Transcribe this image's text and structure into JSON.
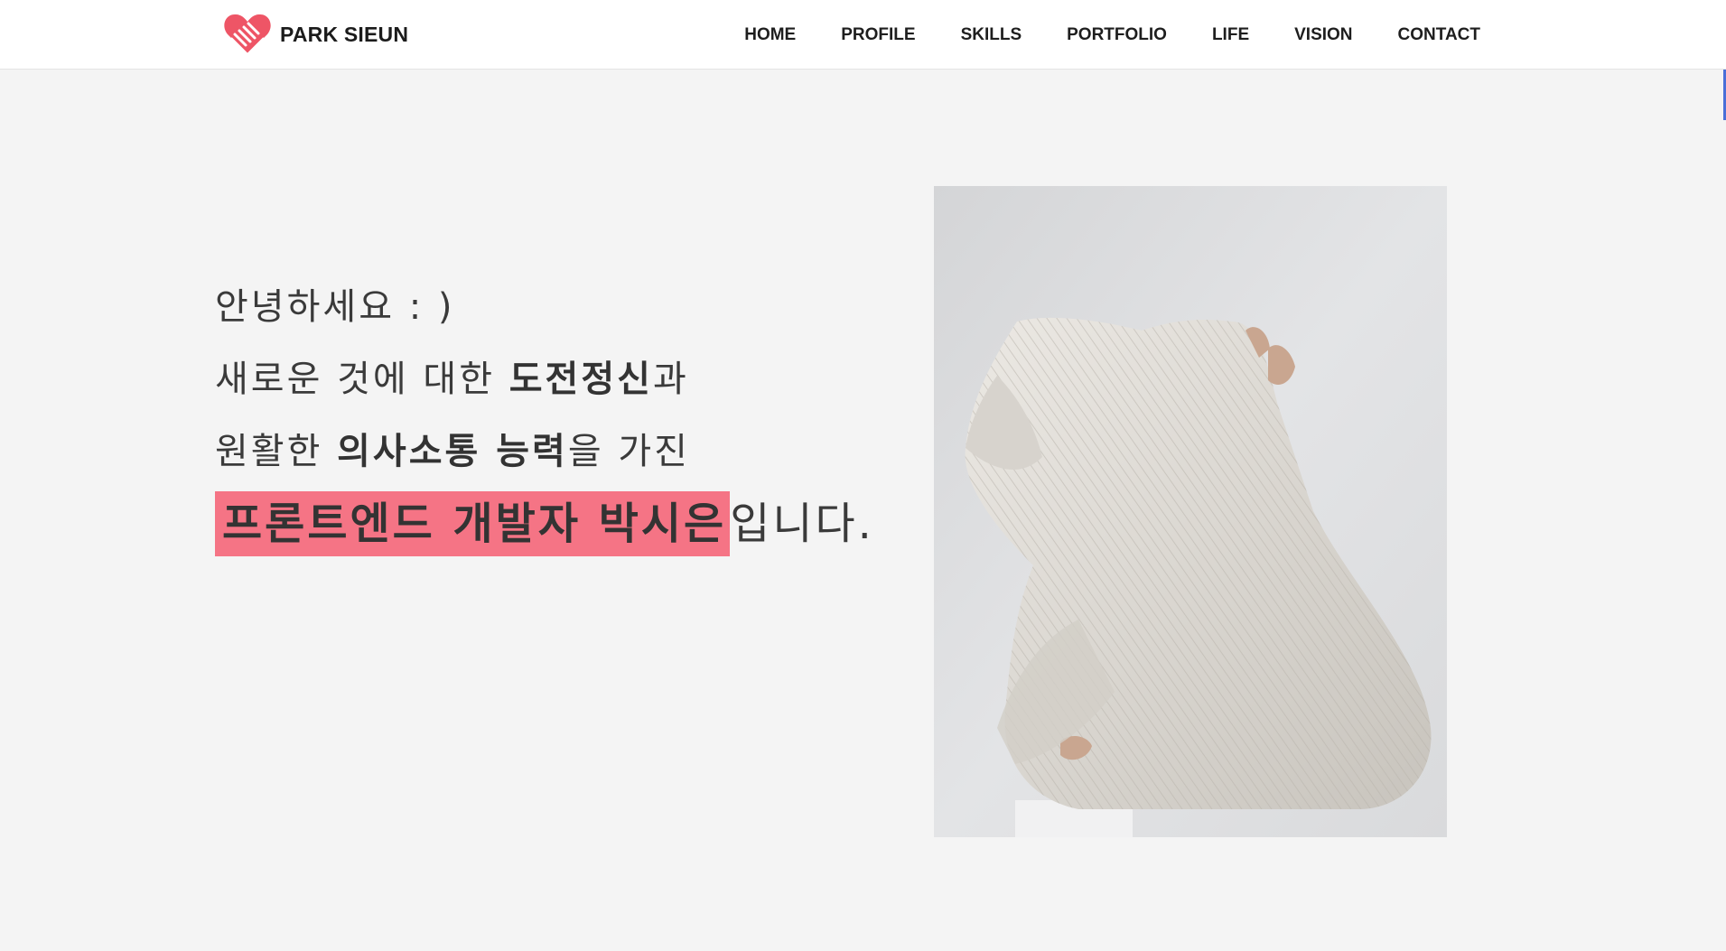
{
  "header": {
    "logo_text": "PARK SIEUN",
    "nav": [
      "HOME",
      "PROFILE",
      "SKILLS",
      "PORTFOLIO",
      "LIFE",
      "VISION",
      "CONTACT"
    ]
  },
  "intro": {
    "greeting": "안녕하세요 : )",
    "line2_pre": "새로운 것에 대한 ",
    "line2_bold": "도전정신",
    "line2_post": "과",
    "line3_pre": "원활한 ",
    "line3_bold": "의사소통 능력",
    "line3_post": "을 가진",
    "line4_highlight": "프론트엔드 개발자 박시은",
    "line4_post": "입니다."
  },
  "colors": {
    "accent": "#f57485",
    "logo_heart": "#ee5566",
    "background": "#f4f4f4",
    "header_bg": "#ffffff"
  },
  "icons": {
    "logo": "heart-handshake-icon"
  }
}
